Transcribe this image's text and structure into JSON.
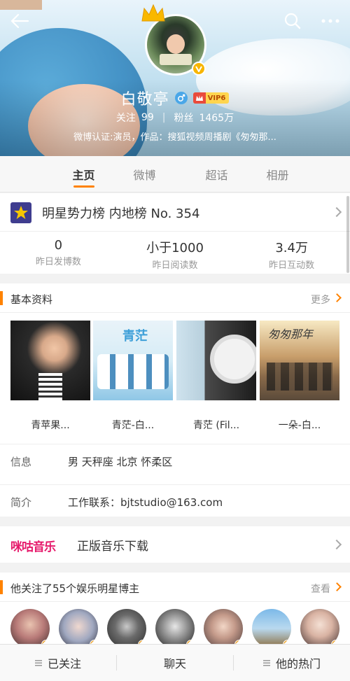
{
  "header": {
    "name": "白敬亭",
    "vip_label": "VIP6",
    "follow_label": "关注",
    "follow_count": "99",
    "fans_label": "粉丝",
    "fans_count": "1465万",
    "certification": "微博认证:演员，作品：搜狐视频周播剧《匆匆那..."
  },
  "tabs": [
    {
      "label": "主页",
      "active": true
    },
    {
      "label": "微博",
      "active": false
    },
    {
      "label": "超话",
      "active": false
    },
    {
      "label": "相册",
      "active": false
    }
  ],
  "ranking": {
    "title": "明星势力榜 内地榜 No. 354",
    "stats": [
      {
        "value": "0",
        "label": "昨日发博数"
      },
      {
        "value": "小于1000",
        "label": "昨日阅读数"
      },
      {
        "value": "3.4万",
        "label": "昨日互动数"
      }
    ]
  },
  "basic_info": {
    "title": "基本资料",
    "more": "更多",
    "albums": [
      {
        "label": "青苹果..."
      },
      {
        "label": "青茫-白..."
      },
      {
        "label": "青茫 (Fil..."
      },
      {
        "label": "一朵-白..."
      }
    ],
    "album_art_text": [
      "青茫",
      "匆匆那年"
    ],
    "info_label": "信息",
    "info_value": "男  天秤座  北京 怀柔区",
    "intro_label": "简介",
    "intro_value": "工作联系：bjtstudio@163.com"
  },
  "music": {
    "logo": "咪咕音乐",
    "text": "正版音乐下载"
  },
  "following": {
    "title": "他关注了55个娱乐明星博主",
    "view": "查看"
  },
  "bottom_bar": [
    {
      "label": "已关注"
    },
    {
      "label": "聊天"
    },
    {
      "label": "他的热门"
    }
  ],
  "colors": {
    "accent": "#ff8200",
    "vip_badge": "#ffd54f",
    "gender": "#4aa7e8"
  }
}
